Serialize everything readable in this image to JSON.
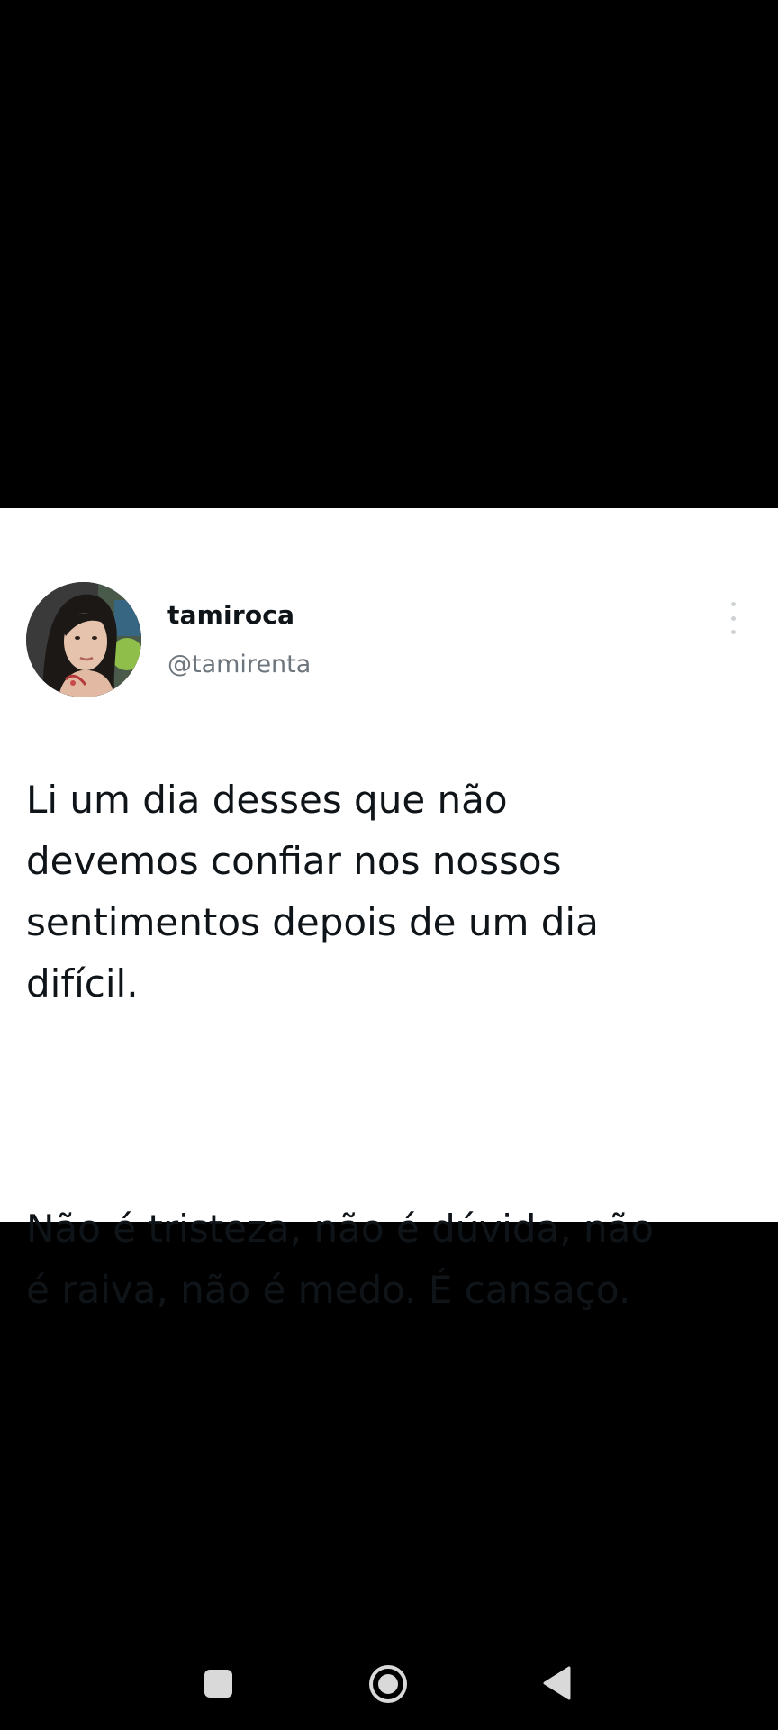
{
  "tweet": {
    "display_name": "tamiroca",
    "handle": "@tamirenta",
    "paragraph_1": "Li um dia desses que não\ndevemos confiar nos nossos\nsentimentos depois de um dia\ndifícil.",
    "paragraph_2": "Não é tristeza, não é dúvida, não\né raiva, não é medo. É cansaço.",
    "avatar_icon": "profile-photo",
    "menu_icon": "more-vertical-icon"
  },
  "nav_bar": {
    "recent_icon": "square-icon",
    "home_icon": "circle-icon",
    "back_icon": "triangle-back-icon"
  },
  "colors": {
    "background": "#000000",
    "card": "#ffffff",
    "text_primary": "#0f1419",
    "text_secondary": "#6e767d"
  }
}
